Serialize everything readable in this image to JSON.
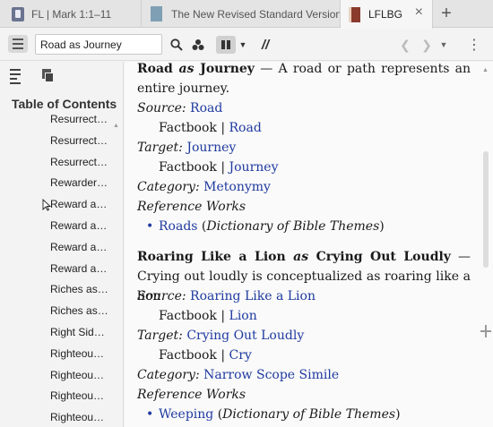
{
  "tabs": [
    {
      "label": "FL | Mark 1:1–11",
      "icon": "book-icon"
    },
    {
      "label": "The New Revised Standard Version",
      "icon": "nrsv-book-icon"
    },
    {
      "label": "LFLBG",
      "icon": "lflbg-book-icon",
      "close": "×"
    }
  ],
  "tab_add": "+",
  "toolbar": {
    "search_value": "Road as Journey",
    "parallel_label": "//"
  },
  "sidebar": {
    "toc_title": "Table of Contents",
    "items": [
      "Resurrect…",
      "Resurrect…",
      "Resurrect…",
      "Rewarder…",
      "Reward a…",
      "Reward a…",
      "Reward a…",
      "Reward a…",
      "Riches as…",
      "Riches as…",
      "Right Sid…",
      "Righteou…",
      "Righteou…",
      "Righteou…",
      "Righteou…"
    ]
  },
  "entries": [
    {
      "title_a": "Road",
      "title_as": "as",
      "title_b": "Journey",
      "desc": " — A road or path represents an entire journey.",
      "source_label": "Source:",
      "source": "Road",
      "source_factbook": "Factbook",
      "source_factbook_link": "Road",
      "target_label": "Target:",
      "target": "Journey",
      "target_factbook": "Factbook",
      "target_factbook_link": "Journey",
      "category_label": "Category:",
      "category": "Metonymy",
      "refworks_label": "Reference Works",
      "ref_link": "Roads",
      "ref_source": "Dictionary of Bible Themes"
    },
    {
      "title_a": "Roaring Like a Lion",
      "title_as": "as",
      "title_b": "Crying Out Loudly",
      "desc": " — Crying out loudly is conceptualized as roaring like a lion.",
      "source_label": "Source:",
      "source": "Roaring Like a Lion",
      "source_factbook": "Factbook",
      "source_factbook_link": "Lion",
      "target_label": "Target:",
      "target": "Crying Out Loudly",
      "target_factbook": "Factbook",
      "target_factbook_link": "Cry",
      "category_label": "Category:",
      "category": "Narrow Scope Simile",
      "refworks_label": "Reference Works",
      "ref_link": "Weeping",
      "ref_source": "Dictionary of Bible Themes"
    }
  ],
  "colors": {
    "link": "#1f3a9f",
    "tab_active": "#f6f6f6",
    "background": "#f3f3f3"
  }
}
